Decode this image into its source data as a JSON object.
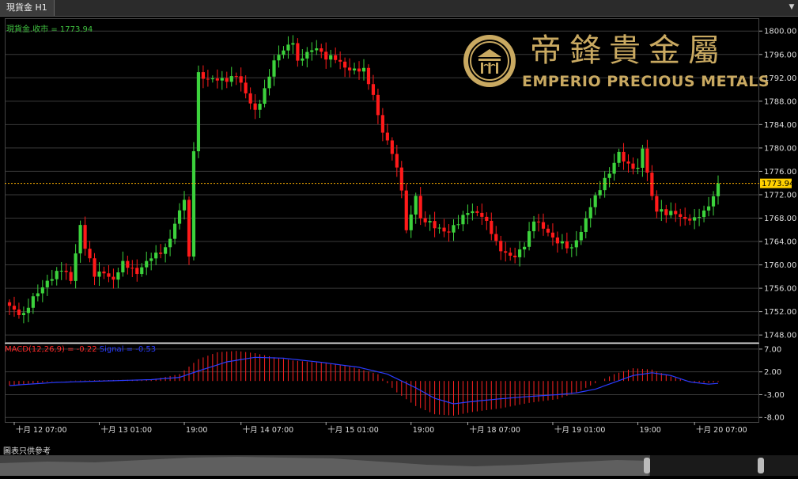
{
  "tab": {
    "title": "現貨金 H1",
    "menu_icon": "dropdown-arrow-icon"
  },
  "legend": {
    "price_label": "現貨金.收市 = 1773.94",
    "macd_label": "MACD(12,26,9) = -0.22",
    "signal_label": "Signal = -0.53"
  },
  "logo": {
    "chinese": "帝鋒貴金屬",
    "english": "EMPERIO PRECIOUS METALS"
  },
  "footer_note": "圖表只供參考",
  "colors": {
    "up": "#3cd23c",
    "down": "#ff1a1a",
    "signal": "#2a3cff",
    "current": "#ffb300",
    "logo": "#c9a961"
  },
  "chart_data": [
    {
      "type": "candlestick",
      "title": "",
      "current_price": 1773.94,
      "current_price_label": "1773.94",
      "ylim": [
        1746.8,
        1802.2
      ],
      "y_ticks": [
        1800.0,
        1796.0,
        1792.0,
        1788.0,
        1784.0,
        1780.0,
        1776.0,
        1772.0,
        1768.0,
        1764.0,
        1760.0,
        1756.0,
        1752.0,
        1748.0
      ],
      "grid": true,
      "x_ticks": [
        {
          "label": "十月 12 07:00",
          "bar": 0
        },
        {
          "label": "十月 13 01:00",
          "bar": 18
        },
        {
          "label": "19:00",
          "bar": 36
        },
        {
          "label": "十月 14 07:00",
          "bar": 48
        },
        {
          "label": "十月 15 01:00",
          "bar": 66
        },
        {
          "label": "19:00",
          "bar": 84
        },
        {
          "label": "十月 18 07:00",
          "bar": 96
        },
        {
          "label": "十月 19 01:00",
          "bar": 114
        },
        {
          "label": "19:00",
          "bar": 132
        },
        {
          "label": "十月 20 07:00",
          "bar": 144
        }
      ],
      "close_path": [
        [
          0,
          1753.0
        ],
        [
          3,
          1751.5
        ],
        [
          5,
          1754.0
        ],
        [
          8,
          1757.5
        ],
        [
          11,
          1759.0
        ],
        [
          13,
          1757.5
        ],
        [
          15,
          1767.0
        ],
        [
          16,
          1763.0
        ],
        [
          18,
          1758.0
        ],
        [
          20,
          1759.0
        ],
        [
          22,
          1757.5
        ],
        [
          24,
          1760.0
        ],
        [
          27,
          1759.0
        ],
        [
          29,
          1760.5
        ],
        [
          31,
          1761.5
        ],
        [
          33,
          1763.0
        ],
        [
          35,
          1767.0
        ],
        [
          37,
          1771.0
        ],
        [
          38,
          1761.0
        ],
        [
          39,
          1780.0
        ],
        [
          40,
          1793.0
        ],
        [
          42,
          1791.5
        ],
        [
          44,
          1791.5
        ],
        [
          46,
          1792.0
        ],
        [
          48,
          1792.5
        ],
        [
          50,
          1789.0
        ],
        [
          52,
          1786.5
        ],
        [
          54,
          1790.0
        ],
        [
          56,
          1794.5
        ],
        [
          58,
          1797.0
        ],
        [
          60,
          1798.5
        ],
        [
          61,
          1794.5
        ],
        [
          63,
          1796.0
        ],
        [
          65,
          1797.5
        ],
        [
          67,
          1795.5
        ],
        [
          69,
          1795.0
        ],
        [
          71,
          1794.0
        ],
        [
          73,
          1793.5
        ],
        [
          75,
          1793.0
        ],
        [
          77,
          1789.0
        ],
        [
          79,
          1783.0
        ],
        [
          81,
          1779.0
        ],
        [
          83,
          1773.0
        ],
        [
          84,
          1766.0
        ],
        [
          85,
          1769.0
        ],
        [
          86,
          1772.0
        ],
        [
          87,
          1767.5
        ],
        [
          89,
          1767.0
        ],
        [
          91,
          1766.5
        ],
        [
          93,
          1765.5
        ],
        [
          95,
          1767.0
        ],
        [
          97,
          1769.5
        ],
        [
          99,
          1769.0
        ],
        [
          101,
          1767.0
        ],
        [
          103,
          1764.0
        ],
        [
          105,
          1762.0
        ],
        [
          107,
          1761.0
        ],
        [
          109,
          1763.5
        ],
        [
          111,
          1768.0
        ],
        [
          113,
          1766.0
        ],
        [
          115,
          1764.5
        ],
        [
          117,
          1764.0
        ],
        [
          119,
          1762.5
        ],
        [
          121,
          1765.5
        ],
        [
          123,
          1770.5
        ],
        [
          125,
          1773.0
        ],
        [
          127,
          1775.5
        ],
        [
          129,
          1779.5
        ],
        [
          131,
          1777.0
        ],
        [
          133,
          1776.0
        ],
        [
          134,
          1780.0
        ],
        [
          136,
          1772.0
        ],
        [
          137,
          1769.5
        ],
        [
          139,
          1768.5
        ],
        [
          141,
          1769.0
        ],
        [
          143,
          1768.0
        ],
        [
          145,
          1767.5
        ],
        [
          147,
          1769.0
        ],
        [
          149,
          1772.0
        ],
        [
          150,
          1773.94
        ]
      ]
    },
    {
      "type": "macd",
      "title": "",
      "ylim": [
        -9.0,
        8.2
      ],
      "y_ticks": [
        7.0,
        2.0,
        -3.0,
        -8.0
      ],
      "histogram_path": [
        [
          0,
          -1.0
        ],
        [
          10,
          0.0
        ],
        [
          20,
          0.2
        ],
        [
          30,
          0.3
        ],
        [
          36,
          1.5
        ],
        [
          40,
          4.8
        ],
        [
          44,
          6.3
        ],
        [
          48,
          6.6
        ],
        [
          52,
          6.1
        ],
        [
          56,
          5.2
        ],
        [
          60,
          4.5
        ],
        [
          66,
          4.0
        ],
        [
          72,
          3.2
        ],
        [
          78,
          1.5
        ],
        [
          82,
          -2.5
        ],
        [
          86,
          -5.5
        ],
        [
          90,
          -7.3
        ],
        [
          94,
          -7.6
        ],
        [
          98,
          -6.8
        ],
        [
          104,
          -6.0
        ],
        [
          110,
          -4.8
        ],
        [
          116,
          -4.0
        ],
        [
          120,
          -2.5
        ],
        [
          124,
          -0.5
        ],
        [
          128,
          1.5
        ],
        [
          132,
          2.8
        ],
        [
          136,
          2.5
        ],
        [
          140,
          1.0
        ],
        [
          144,
          -0.2
        ],
        [
          148,
          -0.4
        ],
        [
          150,
          -0.22
        ]
      ],
      "signal_path": [
        [
          0,
          -1.0
        ],
        [
          10,
          -0.3
        ],
        [
          20,
          0.0
        ],
        [
          30,
          0.3
        ],
        [
          36,
          0.8
        ],
        [
          40,
          2.2
        ],
        [
          46,
          4.2
        ],
        [
          52,
          5.2
        ],
        [
          58,
          5.0
        ],
        [
          66,
          4.1
        ],
        [
          74,
          3.0
        ],
        [
          80,
          1.5
        ],
        [
          86,
          -1.5
        ],
        [
          90,
          -3.8
        ],
        [
          94,
          -5.0
        ],
        [
          98,
          -4.5
        ],
        [
          104,
          -3.9
        ],
        [
          110,
          -3.4
        ],
        [
          116,
          -3.0
        ],
        [
          120,
          -2.6
        ],
        [
          124,
          -1.8
        ],
        [
          128,
          -0.3
        ],
        [
          132,
          1.2
        ],
        [
          136,
          1.8
        ],
        [
          140,
          1.2
        ],
        [
          144,
          -0.2
        ],
        [
          148,
          -0.7
        ],
        [
          150,
          -0.53
        ]
      ]
    }
  ]
}
